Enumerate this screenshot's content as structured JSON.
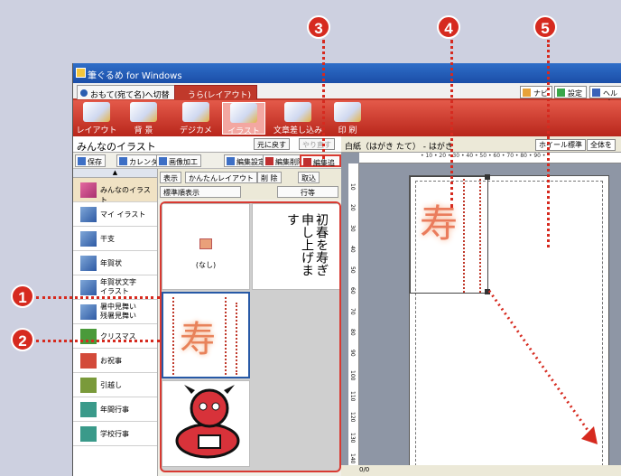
{
  "app": {
    "title": "筆ぐるめ for Windows"
  },
  "tabs": [
    {
      "label": "おもて(宛て名)へ切替"
    },
    {
      "label": "うら(レイアウト)"
    }
  ],
  "top_right": {
    "navi": "ナビ",
    "settings": "設定",
    "help": "ヘルプ"
  },
  "ribbon": [
    {
      "label": "レイアウト"
    },
    {
      "label": "背 景"
    },
    {
      "label": "デジカメ"
    },
    {
      "label": "イラスト"
    },
    {
      "label": "文章差し込み"
    },
    {
      "label": "印 刷"
    }
  ],
  "panel": {
    "title": "みんなのイラスト",
    "undo": "元に戻す",
    "redo": "やり直す",
    "toolbar": [
      "保存",
      "カレンダー",
      "画像加工",
      "編集設定",
      "編集削除",
      "編集追加"
    ]
  },
  "gallery_toolbar": {
    "show": "表示",
    "easy_layout": "かんたんレイアウト",
    "delete": "削 除",
    "import": "取込",
    "sort": "標準順表示",
    "rows": "行等"
  },
  "categories": [
    {
      "label": "みんなのイラスト"
    },
    {
      "label": "マイ イラスト"
    },
    {
      "label": "干支"
    },
    {
      "label": "年賀状"
    },
    {
      "label": "年賀状文字\nイラスト"
    },
    {
      "label": "暑中見舞い\n残暑見舞い"
    },
    {
      "label": "クリスマス"
    },
    {
      "label": "お祝事"
    },
    {
      "label": "引越し"
    },
    {
      "label": "年間行事"
    },
    {
      "label": "学校行事"
    }
  ],
  "gallery": {
    "none_label": "(なし)",
    "calligraphy": "初春を寿ぎ申し上げます",
    "kotobuki": "寿"
  },
  "document": {
    "title": "白紙（はがき たて） - はがき",
    "zoom": "ホイール標準",
    "view": "全体を",
    "ruler_h": "• 10 • 20 • 30 • 40 • 50 • 60 • 70 • 80 • 90 •",
    "ruler_v": [
      "10",
      "20",
      "30",
      "40",
      "50",
      "60",
      "70",
      "80",
      "90",
      "100",
      "110",
      "120",
      "130",
      "140"
    ],
    "page_ind": "0/0"
  },
  "callouts": [
    "1",
    "2",
    "3",
    "4",
    "5"
  ],
  "colors": {
    "accent": "#d62a1f",
    "ribbon": "#c0392b",
    "selection": "#2759a6"
  }
}
